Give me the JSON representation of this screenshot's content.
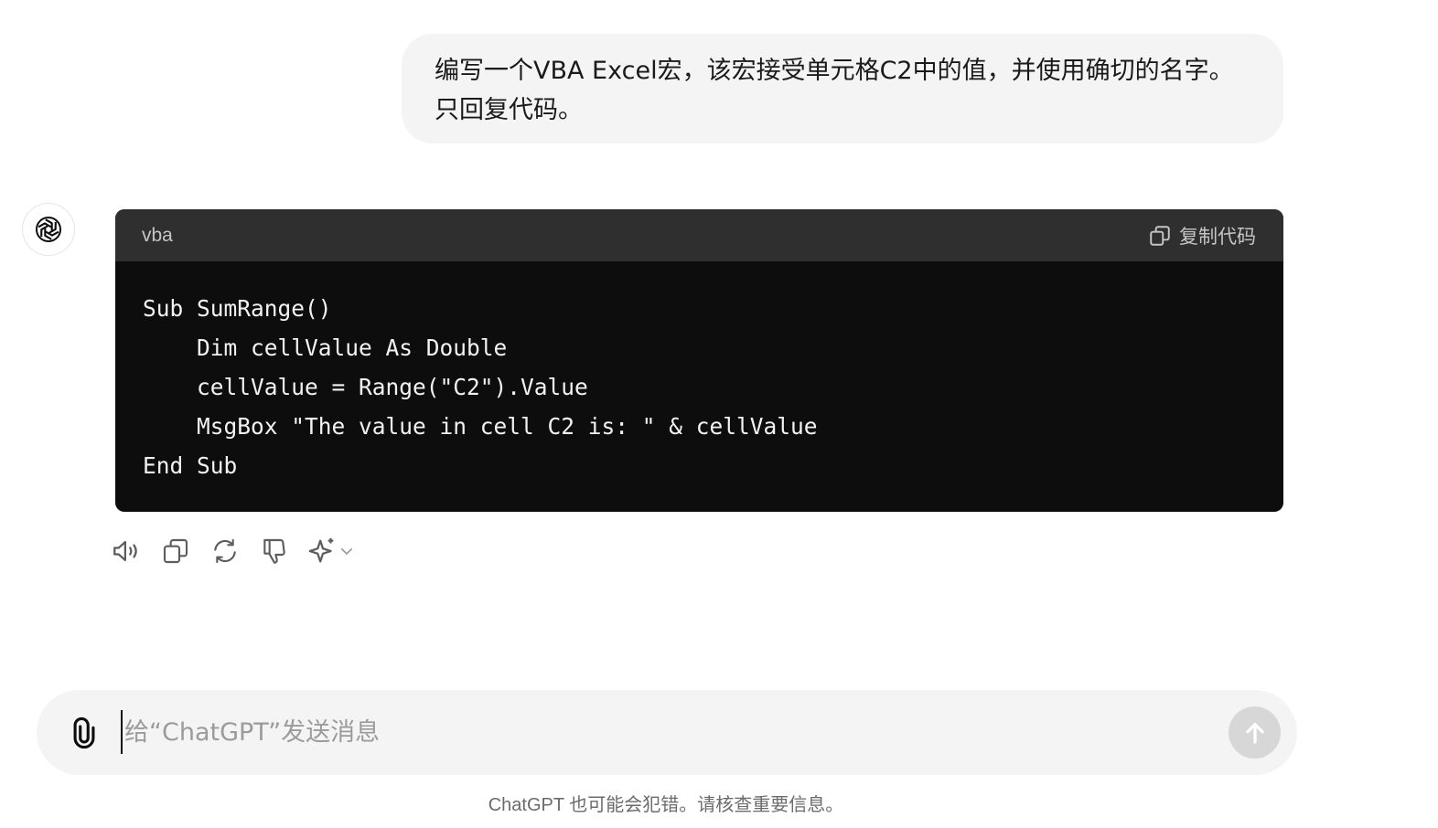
{
  "user_message": {
    "text": "编写一个VBA Excel宏，该宏接受单元格C2中的值，并使用确切的名字。只回复代码。"
  },
  "assistant": {
    "avatar_icon": "openai-logo-icon",
    "code_block": {
      "language": "vba",
      "copy_label": "复制代码",
      "lines": [
        "Sub SumRange()",
        "    Dim cellValue As Double",
        "    cellValue = Range(\"C2\").Value",
        "    MsgBox \"The value in cell C2 is: \" & cellValue",
        "End Sub"
      ]
    },
    "actions": [
      {
        "name": "read-aloud-icon"
      },
      {
        "name": "copy-icon"
      },
      {
        "name": "regenerate-icon"
      },
      {
        "name": "thumbs-down-icon"
      },
      {
        "name": "sparkle-model-icon"
      }
    ]
  },
  "composer": {
    "placeholder": "给“ChatGPT”发送消息",
    "value": ""
  },
  "disclaimer": "ChatGPT 也可能会犯错。请核查重要信息。"
}
